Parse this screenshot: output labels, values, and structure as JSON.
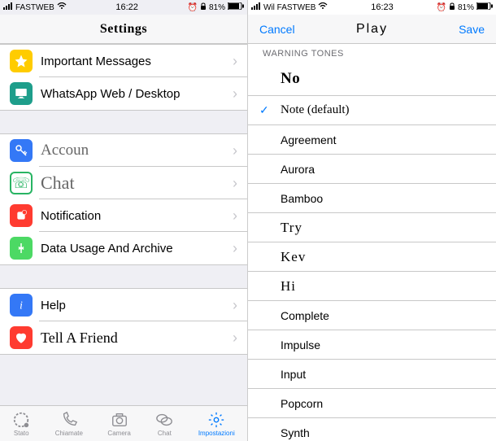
{
  "left": {
    "status": {
      "carrier": "FASTWEB",
      "time": "16:22",
      "battery": "81%"
    },
    "header": {
      "title": "Settings"
    },
    "groups": [
      {
        "items": [
          {
            "id": "important",
            "label": "Important Messages",
            "icon": "star-icon",
            "color": "ic-star"
          },
          {
            "id": "web",
            "label": "WhatsApp Web / Desktop",
            "icon": "desktop-icon",
            "color": "ic-desktop"
          }
        ]
      },
      {
        "items": [
          {
            "id": "account",
            "label": "Accoun",
            "icon": "key-icon",
            "color": "ic-key",
            "emph": true
          },
          {
            "id": "chat",
            "label": "Chat",
            "icon": "whatsapp-icon",
            "color": "ic-chat",
            "emph": true,
            "big": true
          },
          {
            "id": "notif",
            "label": "Notification",
            "icon": "bell-icon",
            "color": "ic-bell"
          },
          {
            "id": "data",
            "label": "Data Usage And Archive",
            "icon": "arrows-icon",
            "color": "ic-data"
          }
        ]
      },
      {
        "items": [
          {
            "id": "help",
            "label": "Help",
            "icon": "info-icon",
            "color": "ic-info"
          },
          {
            "id": "tell",
            "label": "Tell A Friend",
            "icon": "heart-icon",
            "color": "ic-heart",
            "emph2": true
          }
        ]
      }
    ],
    "tabs": [
      {
        "id": "stato",
        "label": "Stato",
        "icon": "status-ring-icon"
      },
      {
        "id": "chiamate",
        "label": "Chiamate",
        "icon": "phone-icon"
      },
      {
        "id": "camera",
        "label": "Camera",
        "icon": "camera-icon"
      },
      {
        "id": "chat",
        "label": "Chat",
        "icon": "chat-bubbles-icon"
      },
      {
        "id": "impostazioni",
        "label": "Impostazioni",
        "icon": "gear-icon",
        "active": true
      }
    ]
  },
  "right": {
    "status": {
      "carrier": "Wil FASTWEB",
      "time": "16:23",
      "battery": "81%"
    },
    "header": {
      "cancel": "Cancel",
      "title": "Play",
      "save": "Save"
    },
    "section": "WARNING TONES",
    "tones": [
      {
        "label": "No",
        "style": "none"
      },
      {
        "label": "Note (default)",
        "selected": true
      },
      {
        "label": "Agreement"
      },
      {
        "label": "Aurora"
      },
      {
        "label": "Bamboo"
      },
      {
        "label": "Try",
        "fancy": true
      },
      {
        "label": "Kev",
        "fancy": true
      },
      {
        "label": "Hi",
        "fancy": true
      },
      {
        "label": "Complete"
      },
      {
        "label": "Impulse"
      },
      {
        "label": "Input"
      },
      {
        "label": "Popcorn"
      },
      {
        "label": "Synth"
      }
    ]
  }
}
